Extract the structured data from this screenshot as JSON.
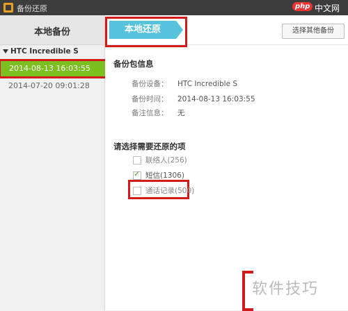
{
  "titlebar": {
    "title": "备份还原"
  },
  "watermark": {
    "badge": "php",
    "text": "中文网",
    "corner_text": "软件技巧"
  },
  "sidebar": {
    "title": "本地备份",
    "device": "HTC Incredible S",
    "backups": [
      {
        "label": "2014-08-13 16:03:55",
        "selected": true
      },
      {
        "label": "2014-07-20 09:01:28",
        "selected": false
      }
    ]
  },
  "tabs": {
    "active_label": "本地还原",
    "other_button": "选择其他备份"
  },
  "info": {
    "section_title": "备份包信息",
    "rows": [
      {
        "key": "备份设备：",
        "value": "HTC Incredible S"
      },
      {
        "key": "备份时间：",
        "value": "2014-08-13 16:03:55"
      },
      {
        "key": "备注信息：",
        "value": "无"
      }
    ]
  },
  "restore": {
    "section_title": "请选择需要还原的项",
    "options": [
      {
        "label": "联络人(256)",
        "checked": false
      },
      {
        "label": "短信(1306)",
        "checked": true
      },
      {
        "label": "通话记录(500)",
        "checked": false
      }
    ]
  },
  "colors": {
    "accent_tab": "#55c3dc",
    "selected_item": "#7cc01f",
    "highlight": "#d21a1a"
  }
}
